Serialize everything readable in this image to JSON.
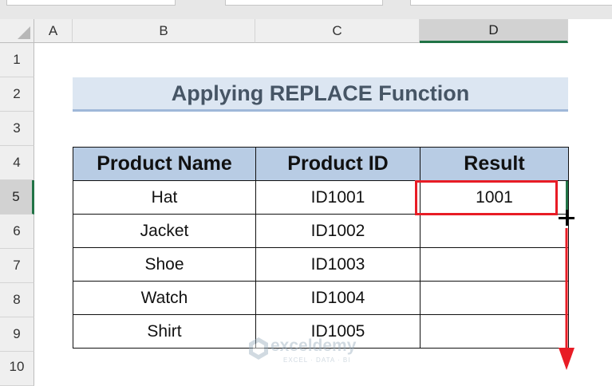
{
  "columns": [
    "A",
    "B",
    "C",
    "D"
  ],
  "rows": [
    "1",
    "2",
    "3",
    "4",
    "5",
    "6",
    "7",
    "8",
    "9",
    "10"
  ],
  "active_cell": {
    "column": "D",
    "row": "5"
  },
  "title": "Applying REPLACE Function",
  "table": {
    "headers": [
      "Product Name",
      "Product ID",
      "Result"
    ],
    "rows": [
      [
        "Hat",
        "ID1001",
        "1001"
      ],
      [
        "Jacket",
        "ID1002",
        ""
      ],
      [
        "Shoe",
        "ID1003",
        ""
      ],
      [
        "Watch",
        "ID1004",
        ""
      ],
      [
        "Shirt",
        "ID1005",
        ""
      ]
    ]
  },
  "watermark": {
    "name": "exceldemy",
    "tagline": "EXCEL · DATA · BI"
  },
  "colors": {
    "header_fill": "#b8cce4",
    "title_fill": "#dce6f2",
    "selection_border": "#e81c25",
    "active_accent": "#217346",
    "arrow": "#e81c25"
  },
  "icons": [
    "fill-handle-cursor-icon",
    "drag-down-arrow-icon",
    "exceldemy-logo-icon",
    "select-all-corner-icon"
  ]
}
